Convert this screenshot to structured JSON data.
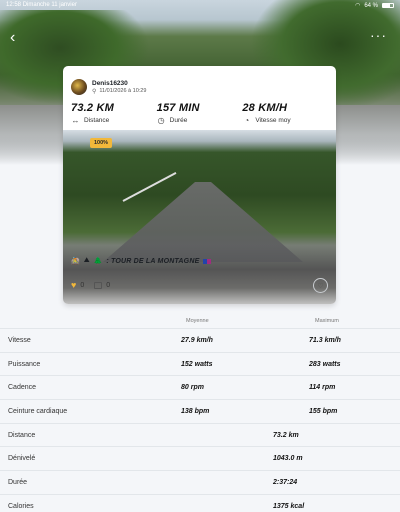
{
  "status_bar": {
    "time": "12:58",
    "date": "Dimanche 11 janvier",
    "battery": "64 %"
  },
  "ride": {
    "user": "Denis16230",
    "date": "11/01/2026 à 10:29",
    "stats": [
      {
        "value": "73.2 KM",
        "label": "Distance",
        "icon": "arrows-horizontal-icon"
      },
      {
        "value": "157 MIN",
        "label": "Durée",
        "icon": "clock-icon"
      },
      {
        "value": "28 KM/H",
        "label": "Vitesse moy",
        "icon": "speedometer-icon"
      }
    ],
    "badge": "100%",
    "title": ": TOUR DE LA MONTAGNE",
    "likes": "0",
    "comments": "0"
  },
  "table": {
    "headers": {
      "avg": "Moyenne",
      "max": "Maximum"
    },
    "rows": [
      {
        "label": "Vitesse",
        "avg": "27.9 km/h",
        "max": "71.3 km/h"
      },
      {
        "label": "Puissance",
        "avg": "152 watts",
        "max": "283  watts"
      },
      {
        "label": "Cadence",
        "avg": "80 rpm",
        "max": "114 rpm"
      },
      {
        "label": "Ceinture cardiaque",
        "avg": "138 bpm",
        "max": "155 bpm"
      }
    ],
    "single_rows": [
      {
        "label": "Distance",
        "value": "73.2 km"
      },
      {
        "label": "Dénivelé",
        "value": "1043.0 m"
      },
      {
        "label": "Durée",
        "value": "2:37:24"
      },
      {
        "label": "Calories",
        "value": "1375 kcal"
      }
    ]
  },
  "colors": {
    "accent": "#f2b83a",
    "background": "#f4f6f9"
  }
}
